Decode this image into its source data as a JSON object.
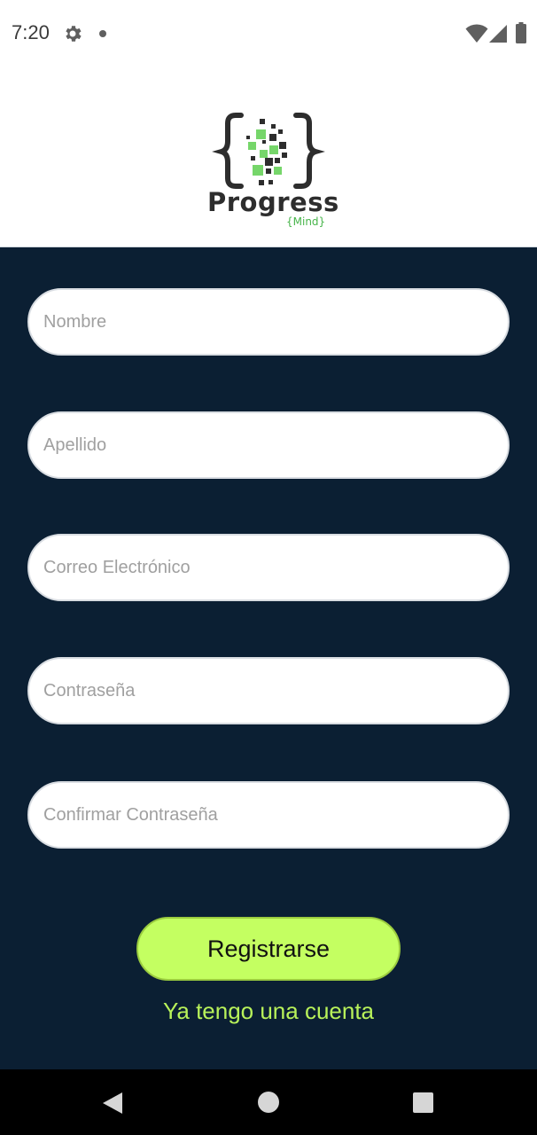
{
  "status_bar": {
    "time": "7:20",
    "icons": [
      "gear-icon",
      "notification-dot-icon",
      "wifi-icon",
      "signal-icon",
      "battery-icon"
    ]
  },
  "logo": {
    "word": "Progress",
    "sub": "{Mind}",
    "colors": {
      "dark": "#2d2d2d",
      "green": "#47b44a",
      "light_green": "#76d66a"
    }
  },
  "form": {
    "fields": [
      {
        "placeholder": "Nombre",
        "value": ""
      },
      {
        "placeholder": "Apellido",
        "value": ""
      },
      {
        "placeholder": "Correo Electrónico",
        "value": ""
      },
      {
        "placeholder": "Contraseña",
        "value": ""
      },
      {
        "placeholder": "Confirmar Contraseña",
        "value": ""
      }
    ],
    "register_label": "Registrarse",
    "have_account_label": "Ya tengo una cuenta"
  },
  "nav_bar": {
    "icons": [
      "back-icon",
      "home-icon",
      "recents-icon"
    ]
  },
  "colors": {
    "panel_bg": "#0b1f33",
    "button_bg": "#c4ff61",
    "link_color": "#b8f25a"
  }
}
